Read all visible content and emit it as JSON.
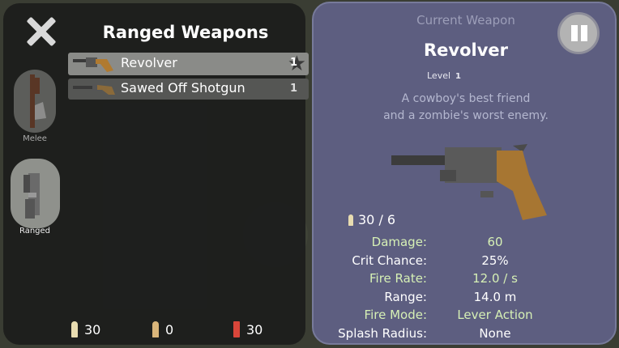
{
  "left_panel": {
    "title": "Ranged Weapons",
    "categories": [
      {
        "label": "Melee",
        "active": false
      },
      {
        "label": "Ranged",
        "active": true
      }
    ],
    "weapons": [
      {
        "name": "Revolver",
        "level": "1",
        "selected": true
      },
      {
        "name": "Sawed Off Shotgun",
        "level": "1",
        "selected": false
      }
    ],
    "ammo": [
      {
        "count": "30",
        "color": "#e8dcb0"
      },
      {
        "count": "0",
        "color": "#d9b57a"
      },
      {
        "count": "30",
        "color": "#d9463a"
      }
    ]
  },
  "right_panel": {
    "header": "Current Weapon",
    "weapon_name": "Revolver",
    "level_label": "Level",
    "level_value": "1",
    "description_line1": "A cowboy's best friend",
    "description_line2": "and a zombie's worst enemy.",
    "ammo_count": "30 / 6",
    "stats": [
      {
        "label": "Damage:",
        "value": "60"
      },
      {
        "label": "Crit Chance:",
        "value": "25%"
      },
      {
        "label": "Fire Rate:",
        "value": "12.0 / s"
      },
      {
        "label": "Range:",
        "value": "14.0 m"
      },
      {
        "label": "Fire Mode:",
        "value": "Lever Action"
      },
      {
        "label": "Splash Radius:",
        "value": "None"
      }
    ]
  },
  "icons": {
    "close": "close-icon",
    "pause": "pause-icon",
    "revolver": "revolver-icon",
    "shotgun": "shotgun-icon",
    "melee": "axe-icon",
    "ranged": "pistol-icon",
    "bullet": "bullet-icon"
  },
  "colors": {
    "left_panel_bg": "#1c1d1c",
    "right_panel_bg": "#5d5e80",
    "selected_row": "#8a8b88",
    "stat_green": "#d6f0b5"
  }
}
